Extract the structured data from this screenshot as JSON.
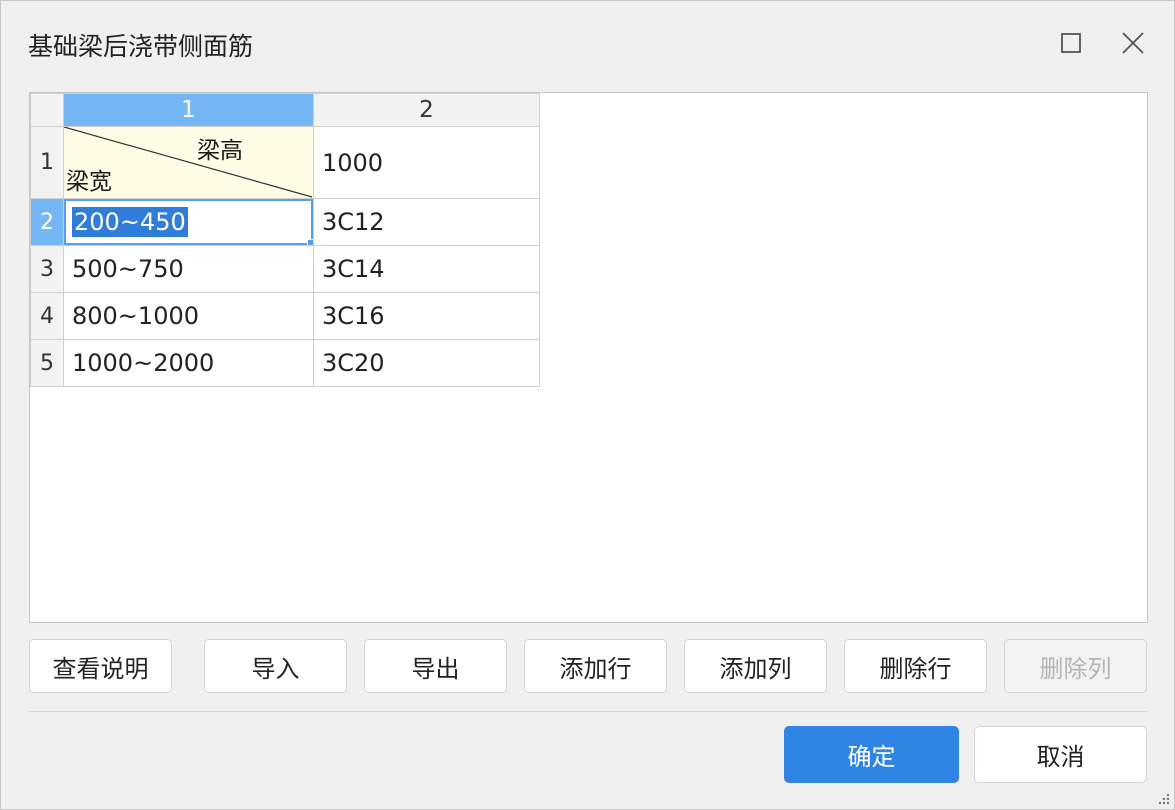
{
  "window": {
    "title": "基础梁后浇带侧面筋",
    "maximize_icon": "maximize-icon",
    "close_icon": "close-icon"
  },
  "grid": {
    "columns": [
      "1",
      "2"
    ],
    "selected_column": "1",
    "header_cell": {
      "top_label": "梁高",
      "bottom_label": "梁宽"
    },
    "rows": [
      {
        "num": "1",
        "col1": "",
        "col2": "1000"
      },
      {
        "num": "2",
        "col1": "200~450",
        "col2": "3C12"
      },
      {
        "num": "3",
        "col1": "500~750",
        "col2": "3C14"
      },
      {
        "num": "4",
        "col1": "800~1000",
        "col2": "3C16"
      },
      {
        "num": "5",
        "col1": "1000~2000",
        "col2": "3C20"
      }
    ],
    "selected_row": "2"
  },
  "toolbar": {
    "view_help": "查看说明",
    "import": "导入",
    "export": "导出",
    "add_row": "添加行",
    "add_col": "添加列",
    "delete_row": "删除行",
    "delete_col": "删除列"
  },
  "footer": {
    "ok": "确定",
    "cancel": "取消"
  },
  "colors": {
    "accent": "#2f84e4",
    "selection_header": "#75b6f5",
    "header_cell_bg": "#fffce6"
  }
}
